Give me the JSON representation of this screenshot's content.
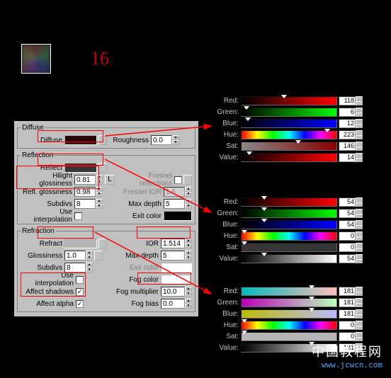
{
  "big_number": "16",
  "diffuse": {
    "legend": "Diffuse",
    "diffuse_lbl": "Diffuse",
    "roughness_lbl": "Roughness",
    "roughness": "0.0"
  },
  "reflection": {
    "legend": "Reflection",
    "reflect_lbl": "Reflect",
    "hg_lbl": "Hilight glossiness",
    "hg": "0.81",
    "rg_lbl": "Refl. glossiness",
    "rg": "0.98",
    "L": "L",
    "subdivs_lbl": "Subdivs",
    "subdivs": "8",
    "interp_lbl": "Use interpolation",
    "fresnel_lbl": "Fresnel reflections",
    "fior_lbl": "Fresnel IOR",
    "fior": "1.6",
    "maxd_lbl": "Max depth",
    "maxd": "5",
    "exit_lbl": "Exit color"
  },
  "refraction": {
    "legend": "Refraction",
    "refract_lbl": "Refract",
    "gloss_lbl": "Glossiness",
    "gloss": "1.0",
    "subdivs_lbl": "Subdivs",
    "subdivs": "8",
    "interp_lbl": "Use interpolation",
    "shadows_lbl": "Affect shadows",
    "shadows": "✓",
    "alpha_lbl": "Affect alpha",
    "alpha": "✓",
    "ior_lbl": "IOR",
    "ior": "1.514",
    "maxd_lbl": "Max depth",
    "maxd": "5",
    "exit_lbl": "Exit color",
    "fog_lbl": "Fog color",
    "fogm_lbl": "Fog multiplier",
    "fogm": "10.0",
    "fogb_lbl": "Fog bias",
    "fogb": "0.0"
  },
  "picker1": {
    "red": "118",
    "green": "6",
    "blue": "12",
    "hue": "223",
    "sat": "146",
    "value": "14"
  },
  "picker2": {
    "red": "54",
    "green": "54",
    "blue": "54",
    "hue": "0",
    "sat": "0",
    "value": "54"
  },
  "picker3": {
    "red": "181",
    "green": "181",
    "blue": "181",
    "hue": "0",
    "sat": "0",
    "value": "181"
  },
  "labels": {
    "red": "Red:",
    "green": "Green:",
    "blue": "Blue:",
    "hue": "Hue:",
    "sat": "Sat:",
    "value": "Value:"
  },
  "watermark": {
    "cn": "中国教程网",
    "url": "www.jcwcn.com"
  }
}
